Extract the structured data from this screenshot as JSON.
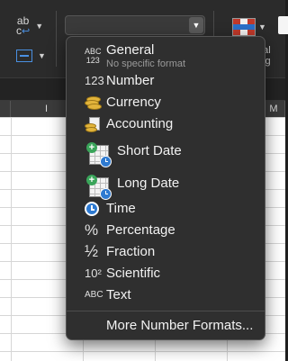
{
  "toolbar": {
    "abc_icon_label": "ab c",
    "number_format_value": "",
    "cell_styles_text_line1": "nal",
    "cell_styles_text_line2": "ing"
  },
  "columns": [
    "I",
    "M"
  ],
  "menu": {
    "items": [
      {
        "icon": "general-abc-123-icon",
        "glyph_top": "ABC",
        "glyph_bottom": "123",
        "label": "General",
        "sublabel": "No specific format"
      },
      {
        "icon": "number-123-icon",
        "glyph": "123",
        "label": "Number"
      },
      {
        "icon": "currency-coins-icon",
        "label": "Currency"
      },
      {
        "icon": "accounting-ledger-icon",
        "label": "Accounting"
      },
      {
        "icon": "short-date-calendar-icon",
        "label": "Short Date"
      },
      {
        "icon": "long-date-calendar-icon",
        "label": "Long Date"
      },
      {
        "icon": "clock-icon",
        "label": "Time"
      },
      {
        "icon": "percent-icon",
        "glyph": "%",
        "label": "Percentage"
      },
      {
        "icon": "fraction-icon",
        "glyph": "½",
        "label": "Fraction"
      },
      {
        "icon": "scientific-icon",
        "glyph": "10²",
        "label": "Scientific"
      },
      {
        "icon": "text-abc-icon",
        "glyph": "ABC",
        "label": "Text"
      }
    ],
    "more_label": "More Number Formats..."
  },
  "colors": {
    "menu_bg": "#2f2f2f",
    "toolbar_bg": "#2b2b2b",
    "accent": "#4a90e2",
    "grid": "#ffffff"
  }
}
